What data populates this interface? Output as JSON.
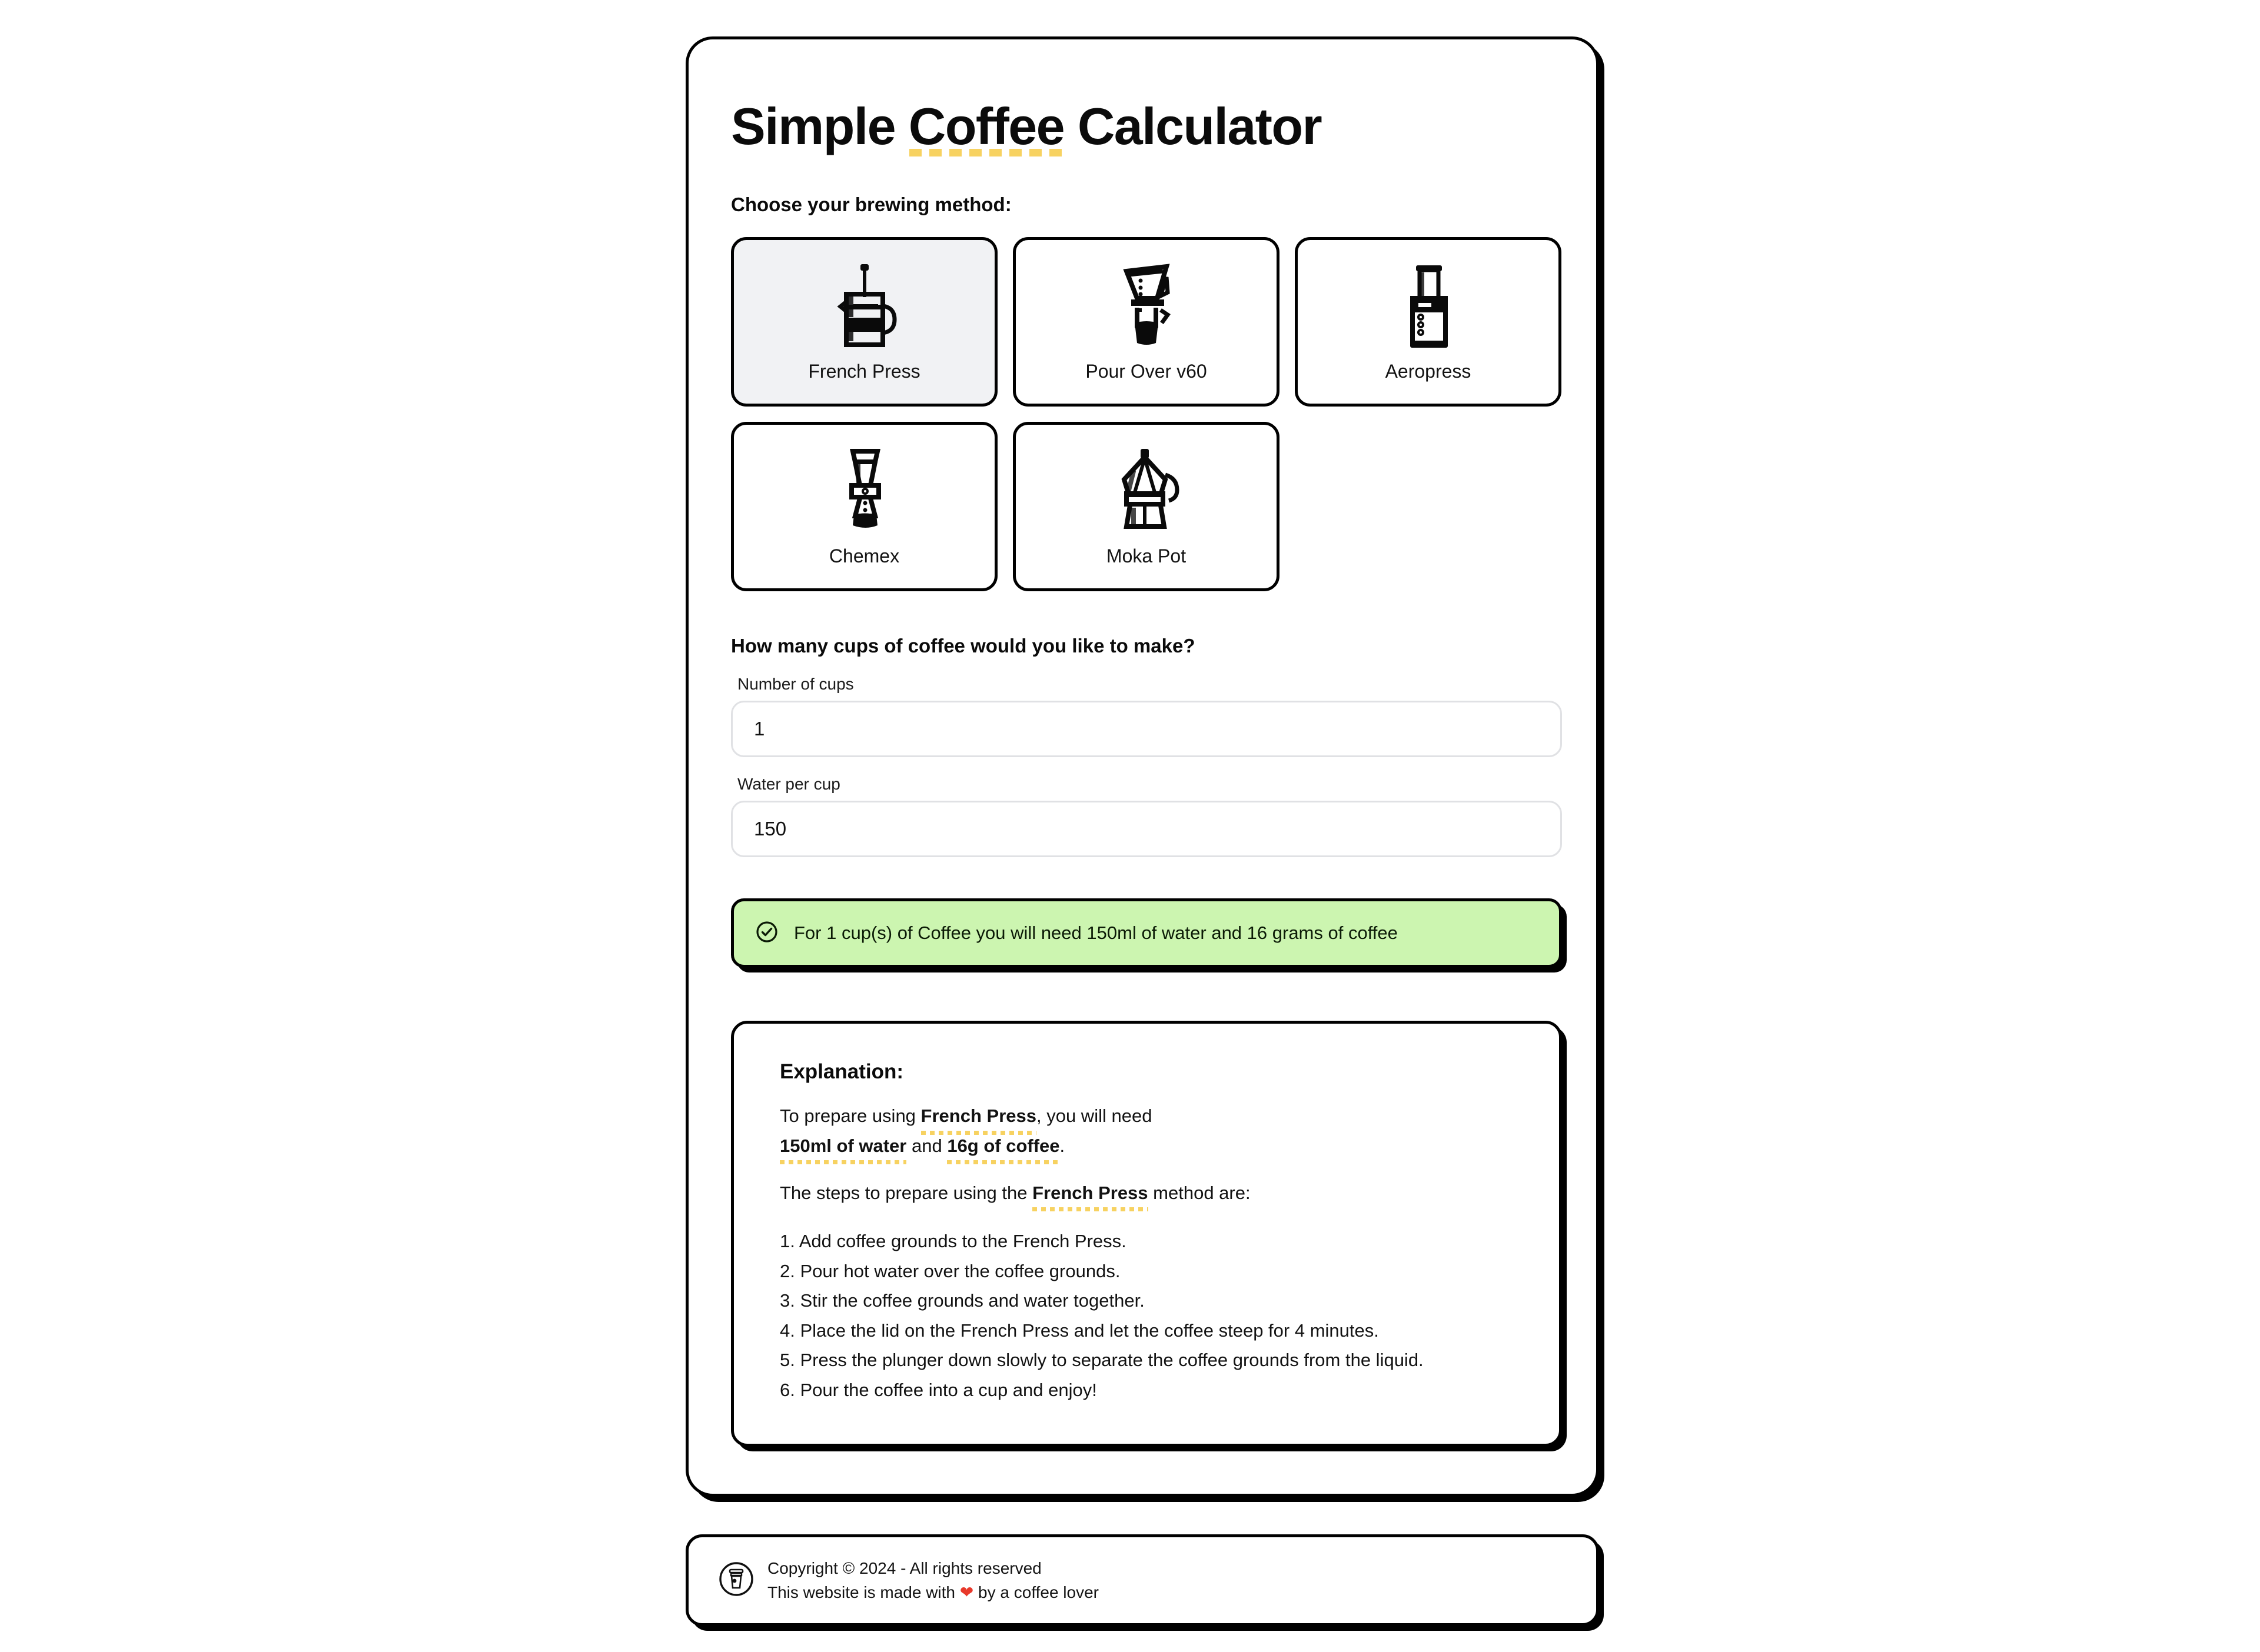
{
  "header": {
    "title_part_1": "Simple ",
    "title_highlight": "Coffee",
    "title_part_2": " Calculator"
  },
  "method_section": {
    "label": "Choose your brewing method:",
    "selected": "French Press",
    "methods": [
      {
        "name": "French Press",
        "icon": "french-press-icon",
        "selected": true
      },
      {
        "name": "Pour Over v60",
        "icon": "pour-over-v60-icon",
        "selected": false
      },
      {
        "name": "Aeropress",
        "icon": "aeropress-icon",
        "selected": false
      },
      {
        "name": "Chemex",
        "icon": "chemex-icon",
        "selected": false
      },
      {
        "name": "Moka Pot",
        "icon": "moka-pot-icon",
        "selected": false
      }
    ]
  },
  "cups_section": {
    "question": "How many cups of coffee would you like to make?",
    "cups_label": "Number of cups",
    "cups_value": "1",
    "water_label": "Water per cup",
    "water_value": "150"
  },
  "result": {
    "icon": "check-circle-icon",
    "text": "For 1 cup(s) of Coffee you will need 150ml of water and 16 grams of coffee",
    "background_color": "#ccf5b0"
  },
  "explanation": {
    "title": "Explanation:",
    "line1_prefix": "To prepare using ",
    "line1_method": "French Press",
    "line1_suffix": ", you will",
    "line2_prefix": "need ",
    "line2_water": "150ml of water",
    "line2_mid": " and ",
    "line2_coffee": "16g of coffee",
    "line2_suffix": ".",
    "line3_prefix": "The steps to prepare using the ",
    "line3_method": "French Press",
    "line3_suffix": " method are:",
    "steps": [
      "1. Add coffee grounds to the French Press.",
      "2. Pour hot water over the coffee grounds.",
      "3. Stir the coffee grounds and water together.",
      "4. Place the lid on the French Press and let the coffee steep for 4 minutes.",
      "5. Press the plunger down slowly to separate the coffee grounds from the liquid.",
      "6. Pour the coffee into a cup and enjoy!"
    ]
  },
  "footer": {
    "icon": "coffee-cup-icon",
    "line1": "Copyright © 2024 - All rights reserved",
    "line2_prefix": "This website is made with ",
    "line2_heart": "❤",
    "line2_suffix": " by a coffee lover"
  },
  "colors": {
    "accent_yellow": "#f7d261",
    "alert_green": "#ccf5b0",
    "selected_card": "#f1f2f4",
    "border": "#000000"
  }
}
